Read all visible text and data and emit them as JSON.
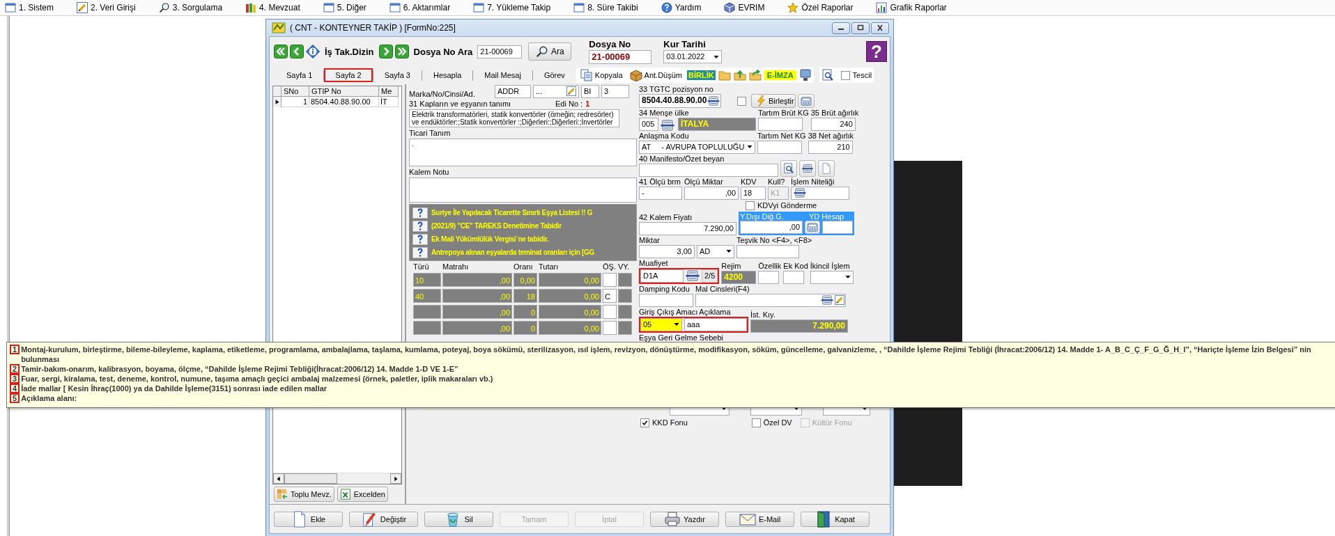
{
  "menu_bar": [
    {
      "label": "1. Sistem"
    },
    {
      "label": "2. Veri Girişi"
    },
    {
      "label": "3. Sorgulama"
    },
    {
      "label": "4. Mevzuat"
    },
    {
      "label": "5. Diğer"
    },
    {
      "label": "6. Aktarımlar"
    },
    {
      "label": "7. Yükleme Takip"
    },
    {
      "label": "8. Süre Takibi"
    },
    {
      "label": "Yardım"
    },
    {
      "label": "EVRIM"
    },
    {
      "label": "Özel Raporlar"
    },
    {
      "label": "Grafik Raporlar"
    }
  ],
  "window": {
    "title": "( CNT - KONTEYNER TAKİP ) [FormNo:225]"
  },
  "toolbar": {
    "index_label": "İş Tak.Dizin",
    "search_label": "Dosya No Ara",
    "search_value": "21-00069",
    "search_button": "Ara",
    "file_no_label": "Dosya No",
    "file_no": "21-00069",
    "rate_date_label": "Kur Tarihi",
    "rate_date": "03.01.2022",
    "help_button": "?"
  },
  "tabs": [
    {
      "label": "Sayfa 1",
      "selected": false
    },
    {
      "label": "Sayfa 2",
      "selected": true
    },
    {
      "label": "Sayfa 3",
      "selected": false
    },
    {
      "label": "Hesapla",
      "selected": false
    },
    {
      "label": "Mail Mesaj",
      "selected": false
    },
    {
      "label": "Görev",
      "selected": false
    }
  ],
  "tab_tools": {
    "copy_button": "Kopyala",
    "deduct_button": "Ant.Düşüm",
    "union_button": "BİRLİK",
    "esign_button": "E-İMZA",
    "registered": {
      "label": "Tescil",
      "checked": false
    }
  },
  "items_grid": {
    "columns": [
      "SNo",
      "GTIP No",
      "Me"
    ],
    "rows": [
      {
        "cells": [
          "1",
          "8504.40.88.90.00",
          "İT"
        ],
        "selected": true
      }
    ],
    "buttons": [
      "Toplu Mevz.",
      "Excelden"
    ]
  },
  "form": {
    "brand": {
      "label": "Marka/No/Cinsi/Ad.",
      "values": [
        "ADDR",
        "...",
        "BI",
        "3"
      ]
    },
    "goods_description": {
      "label": "31 Kapların ve eşyanın tanımı",
      "edi_label": "Edi No :",
      "edi_value": "1",
      "text": "Elektrik transformatörleri, statik konvertörler (örneğin; redresörler) ve endüktörler:;Statik konvertörler :;Diğerleri:;Diğerleri:;İnvertörler"
    },
    "trade_description": {
      "label": "Ticari Tanım",
      "text": "."
    },
    "item_note": {
      "label": "Kalem Notu"
    },
    "warnings": [
      {
        "text": "Suriye İle Yapılacak Ticarette Sınırlı Eşya Listesi !! G"
      },
      {
        "text": "(2021/9) \"CE\" TAREKS Denetimine Tabidir"
      },
      {
        "text": "Ek Mali Yükümlülük Vergisi`ne tabidir."
      },
      {
        "text": "Antrepoya alınan eşyalarda teminat oranları için [GG"
      }
    ],
    "taxes": {
      "columns": [
        "Türü",
        "Matrahı",
        "Oranı",
        "Tutarı",
        "ÖŞ.",
        "VY."
      ],
      "rows": [
        {
          "type": "10",
          "base": ",00",
          "rate": "0,00",
          "amount": "0,00"
        },
        {
          "type": "40",
          "base": ",00",
          "rate": "18",
          "amount": "0,00",
          "os": "C"
        },
        {
          "base": ",00",
          "rate": "0",
          "amount": "0,00"
        },
        {
          "base": ",00",
          "rate": "0",
          "amount": "0,00"
        }
      ]
    },
    "tariff": {
      "label": "33 TGTC pozisyon no",
      "value": "8504.40.88.90.00",
      "option_checked": false,
      "merge_button": "Birleştir"
    },
    "origin": {
      "label": "34 Menşe ülke",
      "code": "005",
      "country": "İTALYA"
    },
    "gross_tare": {
      "label": "Tartım Brüt KG"
    },
    "gross_weight": {
      "label": "35 Brüt ağırlık",
      "value": "240"
    },
    "agreement": {
      "label": "Anlaşma Kodu",
      "value": "AT     - AVRUPA TOPLULUĞU"
    },
    "net_tare": {
      "label": "Tartım Net KG"
    },
    "net_weight": {
      "label": "38 Net ağırlık",
      "value": "210"
    },
    "manifest": {
      "label": "40 Manifesto/Özet beyan"
    },
    "unit": {
      "label": "41 Ölçü brm",
      "value": "-"
    },
    "unit_quantity": {
      "label": "Ölçü Miktar",
      "value": ",00"
    },
    "vat": {
      "label": "KDV",
      "value": "18"
    },
    "usage": {
      "label": "Kull?",
      "value": "K1",
      "disabled": true
    },
    "operation_type": {
      "label": "İşlem Niteliği"
    },
    "skip_vat": {
      "label": "KDVyi Gönderme",
      "checked": false
    },
    "item_price": {
      "label": "42 Kalem Fiyatı",
      "value": "7.290,00"
    },
    "foreign_costs": {
      "label": "Y.Dışı Diğ.G.",
      "value": ",00",
      "account_label": "YD Hesap"
    },
    "quantity": {
      "label": "Miktar",
      "value": "3,00",
      "unit": "AD"
    },
    "incentive": {
      "label": "Teşvik No <F4>, <F8>"
    },
    "exemption": {
      "label": "Muafiyet",
      "value": "D1A",
      "counter": "2/5",
      "highlighted": true
    },
    "regime": {
      "label": "Rejim",
      "value": "4200"
    },
    "feature": {
      "label": "Özellik"
    },
    "extra_code": {
      "label": "Ek Kod"
    },
    "secondary_operation": {
      "label": "İkincil İşlem"
    },
    "dumping": {
      "label": "Damping Kodu"
    },
    "goods_types": {
      "label": "Mal Cinsleri(F4)"
    },
    "purpose": {
      "label": "Giriş Çıkış Amacı",
      "value": "05",
      "note_label": "Açıklama",
      "note": "aaa",
      "highlighted": true
    },
    "statistical_value": {
      "label": "İst. Kıy.",
      "value": "7.290,00"
    },
    "return_reason": {
      "label": "Eşya Geri Gelme Sebebi"
    },
    "funds": [
      {
        "label": "KKD Fonu",
        "checked": true,
        "disabled": false
      },
      {
        "label": "Özel DV",
        "checked": false,
        "disabled": false
      },
      {
        "label": "Kültür Fonu",
        "checked": false,
        "disabled": true
      }
    ]
  },
  "actions": [
    {
      "label": "Ekle",
      "disabled": false
    },
    {
      "label": "Değiştir",
      "disabled": false
    },
    {
      "label": "Sil",
      "disabled": false
    },
    {
      "label": "Tamam",
      "disabled": true
    },
    {
      "label": "İptal",
      "disabled": true
    },
    {
      "label": "Yazdır",
      "disabled": false
    },
    {
      "label": "E-Mail",
      "disabled": false
    },
    {
      "label": "Kapat",
      "disabled": false
    }
  ],
  "hint": [
    {
      "number": "1",
      "text": "Montaj-kurulum, birleştirme, bileme-bileyleme, kaplama, etiketleme, programlama, ambalajlama, taşlama, kumlama, poteyaj, boya sökümü, sterilizasyon, ısıl işlem, revizyon, dönüştürme, modifikasyon, söküm, güncelleme, galvanizleme, ,  “Dahilde İşleme Rejimi Tebliği (İhracat:2006/12) 14. Madde 1- A_B_C_Ç_F_G_Ğ_H_I”, “Hariçte İşleme İzin Belgesi” nin bulunması"
    },
    {
      "number": "2",
      "text": "Tamir-bakım-onarım, kalibrasyon, boyama, ölçme,  “Dahilde İşleme Rejimi Tebliği(İhracat:2006/12) 14. Madde 1-D VE 1-E”"
    },
    {
      "number": "3",
      "text": "Fuar, sergi, kiralama, test, deneme, kontrol, numune, taşıma amaçlı geçici ambalaj malzemesi (örnek, paletler, iplik makaraları vb.)"
    },
    {
      "number": "4",
      "text": "İade mallar [ Kesin İhraç(1000) ya da Dahilde İşleme(3151) sonrası iade edilen mallar"
    },
    {
      "number": "5",
      "text": "Açıklama alanı:"
    }
  ]
}
